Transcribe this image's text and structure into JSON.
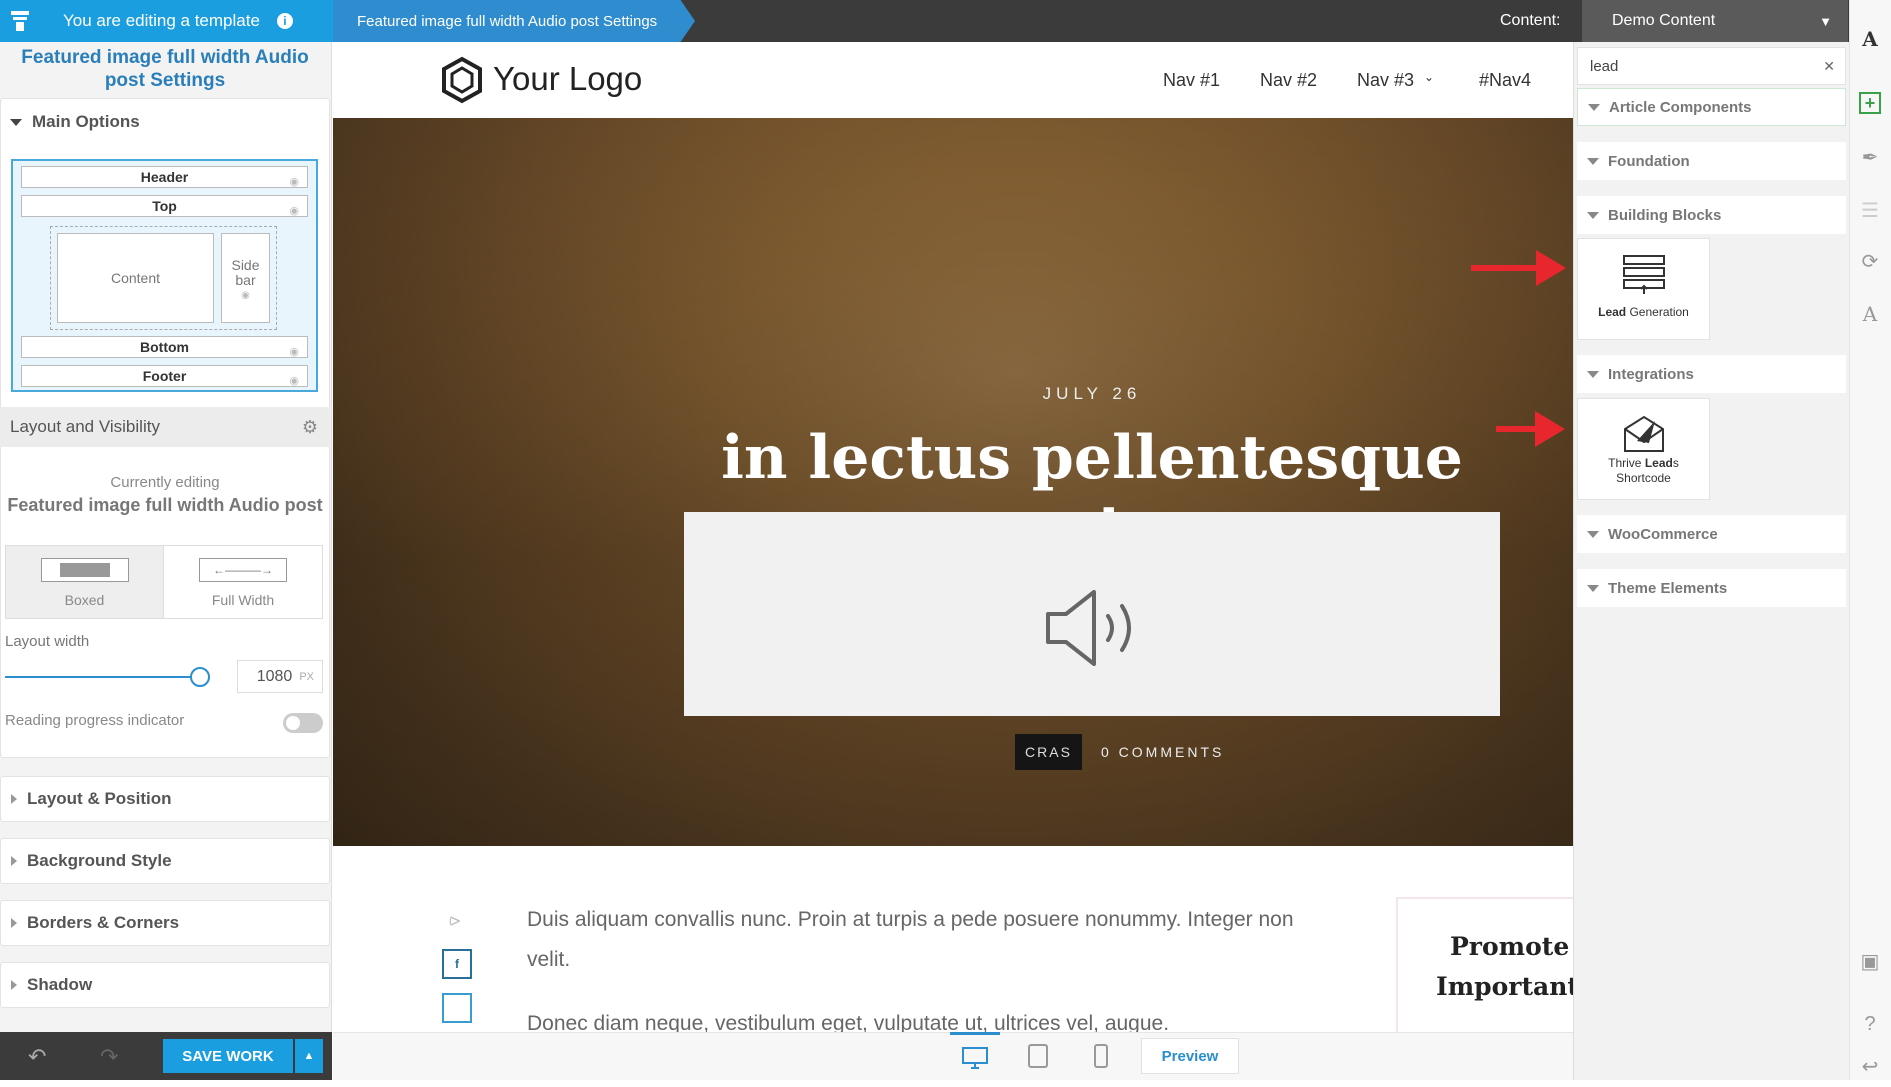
{
  "topbar": {
    "template_notice": "You are editing a template",
    "breadcrumb": "Featured image full width Audio post Settings",
    "content_label": "Content:",
    "content_value": "Demo Content"
  },
  "left_panel": {
    "title": "Featured image full width Audio post Settings",
    "main_options": "Main Options",
    "layout": {
      "header": "Header",
      "top": "Top",
      "content": "Content",
      "sidebar_line1": "Side",
      "sidebar_line2": "bar",
      "bottom": "Bottom",
      "footer": "Footer"
    },
    "layout_visibility": "Layout and Visibility",
    "currently_editing_label": "Currently editing",
    "currently_editing_value": "Featured image full width Audio post",
    "boxed_label": "Boxed",
    "full_width_label": "Full Width",
    "layout_width_label": "Layout width",
    "layout_width_value": "1080",
    "layout_width_unit": "PX",
    "layout_width_slider": 1.0,
    "reading_progress_label": "Reading progress indicator",
    "reading_progress_on": false,
    "sections": [
      "Layout & Position",
      "Background Style",
      "Borders & Corners",
      "Shadow"
    ],
    "save_label": "SAVE WORK"
  },
  "site": {
    "logo_text": "Your Logo",
    "nav": [
      "Nav #1",
      "Nav #2",
      "Nav #3",
      "#Nav4"
    ],
    "post_date": "JULY 26",
    "post_title": "in lectus pellentesque at",
    "category": "CRAS",
    "comments": "0 COMMENTS",
    "paragraph1": "Duis aliquam convallis nunc. Proin at turpis a pede posuere nonummy. Integer non velit.",
    "paragraph2": "Donec diam neque, vestibulum eget, vulputate ut, ultrices vel, augue.",
    "promo_line1": "Promote Y",
    "promo_line2": "Important"
  },
  "bottom_bar": {
    "preview_label": "Preview"
  },
  "right_panel": {
    "search_value": "lead",
    "categories": [
      "Article Components",
      "Foundation",
      "Building Blocks",
      "Integrations",
      "WooCommerce",
      "Theme Elements"
    ],
    "lead_generation_bold": "Lead",
    "lead_generation_rest": " Generation",
    "thrive_leads_pre": "Thrive ",
    "thrive_leads_bold": "Lead",
    "thrive_leads_post": "s",
    "thrive_leads_line2": "Shortcode"
  },
  "colors": {
    "accent_blue": "#1a9ee0",
    "save_button": "#1a9ee0",
    "rail_add_green": "#3aa14b",
    "highlight_arrow": "#e8262e"
  }
}
